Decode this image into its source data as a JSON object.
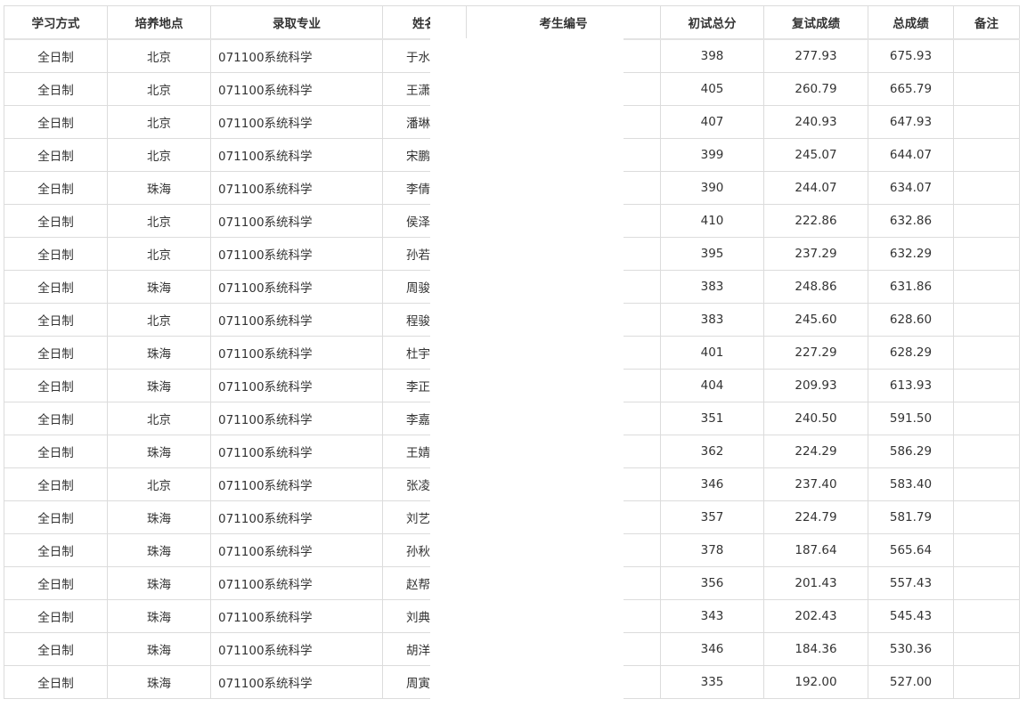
{
  "table": {
    "headers": [
      "学习方式",
      "培养地点",
      "录取专业",
      "姓名",
      "考生编号",
      "初试总分",
      "复试成绩",
      "总成绩",
      "备注"
    ],
    "rows": [
      {
        "mode": "全日制",
        "location": "北京",
        "major": "071100系统科学",
        "name": "于水",
        "exam_id": "",
        "initial": "398",
        "retest": "277.93",
        "total": "675.93",
        "note": ""
      },
      {
        "mode": "全日制",
        "location": "北京",
        "major": "071100系统科学",
        "name": "王潇",
        "exam_id": "",
        "initial": "405",
        "retest": "260.79",
        "total": "665.79",
        "note": ""
      },
      {
        "mode": "全日制",
        "location": "北京",
        "major": "071100系统科学",
        "name": "潘琳",
        "exam_id": "",
        "initial": "407",
        "retest": "240.93",
        "total": "647.93",
        "note": ""
      },
      {
        "mode": "全日制",
        "location": "北京",
        "major": "071100系统科学",
        "name": "宋鹏",
        "exam_id": "",
        "initial": "399",
        "retest": "245.07",
        "total": "644.07",
        "note": ""
      },
      {
        "mode": "全日制",
        "location": "珠海",
        "major": "071100系统科学",
        "name": "李倩",
        "exam_id": "",
        "initial": "390",
        "retest": "244.07",
        "total": "634.07",
        "note": ""
      },
      {
        "mode": "全日制",
        "location": "北京",
        "major": "071100系统科学",
        "name": "侯泽",
        "exam_id": "",
        "initial": "410",
        "retest": "222.86",
        "total": "632.86",
        "note": ""
      },
      {
        "mode": "全日制",
        "location": "北京",
        "major": "071100系统科学",
        "name": "孙若",
        "exam_id": "",
        "initial": "395",
        "retest": "237.29",
        "total": "632.29",
        "note": ""
      },
      {
        "mode": "全日制",
        "location": "珠海",
        "major": "071100系统科学",
        "name": "周骏",
        "exam_id": "",
        "initial": "383",
        "retest": "248.86",
        "total": "631.86",
        "note": ""
      },
      {
        "mode": "全日制",
        "location": "北京",
        "major": "071100系统科学",
        "name": "程骏",
        "exam_id": "",
        "initial": "383",
        "retest": "245.60",
        "total": "628.60",
        "note": ""
      },
      {
        "mode": "全日制",
        "location": "珠海",
        "major": "071100系统科学",
        "name": "杜宇",
        "exam_id": "",
        "initial": "401",
        "retest": "227.29",
        "total": "628.29",
        "note": ""
      },
      {
        "mode": "全日制",
        "location": "珠海",
        "major": "071100系统科学",
        "name": "李正",
        "exam_id": "",
        "initial": "404",
        "retest": "209.93",
        "total": "613.93",
        "note": ""
      },
      {
        "mode": "全日制",
        "location": "北京",
        "major": "071100系统科学",
        "name": "李嘉",
        "exam_id": "",
        "initial": "351",
        "retest": "240.50",
        "total": "591.50",
        "note": ""
      },
      {
        "mode": "全日制",
        "location": "珠海",
        "major": "071100系统科学",
        "name": "王婧",
        "exam_id": "",
        "initial": "362",
        "retest": "224.29",
        "total": "586.29",
        "note": ""
      },
      {
        "mode": "全日制",
        "location": "北京",
        "major": "071100系统科学",
        "name": "张凌",
        "exam_id": "",
        "initial": "346",
        "retest": "237.40",
        "total": "583.40",
        "note": ""
      },
      {
        "mode": "全日制",
        "location": "珠海",
        "major": "071100系统科学",
        "name": "刘艺",
        "exam_id": "",
        "initial": "357",
        "retest": "224.79",
        "total": "581.79",
        "note": ""
      },
      {
        "mode": "全日制",
        "location": "珠海",
        "major": "071100系统科学",
        "name": "孙秋",
        "exam_id": "",
        "initial": "378",
        "retest": "187.64",
        "total": "565.64",
        "note": ""
      },
      {
        "mode": "全日制",
        "location": "珠海",
        "major": "071100系统科学",
        "name": "赵帮",
        "exam_id": "",
        "initial": "356",
        "retest": "201.43",
        "total": "557.43",
        "note": ""
      },
      {
        "mode": "全日制",
        "location": "珠海",
        "major": "071100系统科学",
        "name": "刘典",
        "exam_id": "",
        "initial": "343",
        "retest": "202.43",
        "total": "545.43",
        "note": ""
      },
      {
        "mode": "全日制",
        "location": "珠海",
        "major": "071100系统科学",
        "name": "胡洋",
        "exam_id": "",
        "initial": "346",
        "retest": "184.36",
        "total": "530.36",
        "note": ""
      },
      {
        "mode": "全日制",
        "location": "珠海",
        "major": "071100系统科学",
        "name": "周寅",
        "exam_id": "",
        "initial": "335",
        "retest": "192.00",
        "total": "527.00",
        "note": ""
      }
    ]
  }
}
